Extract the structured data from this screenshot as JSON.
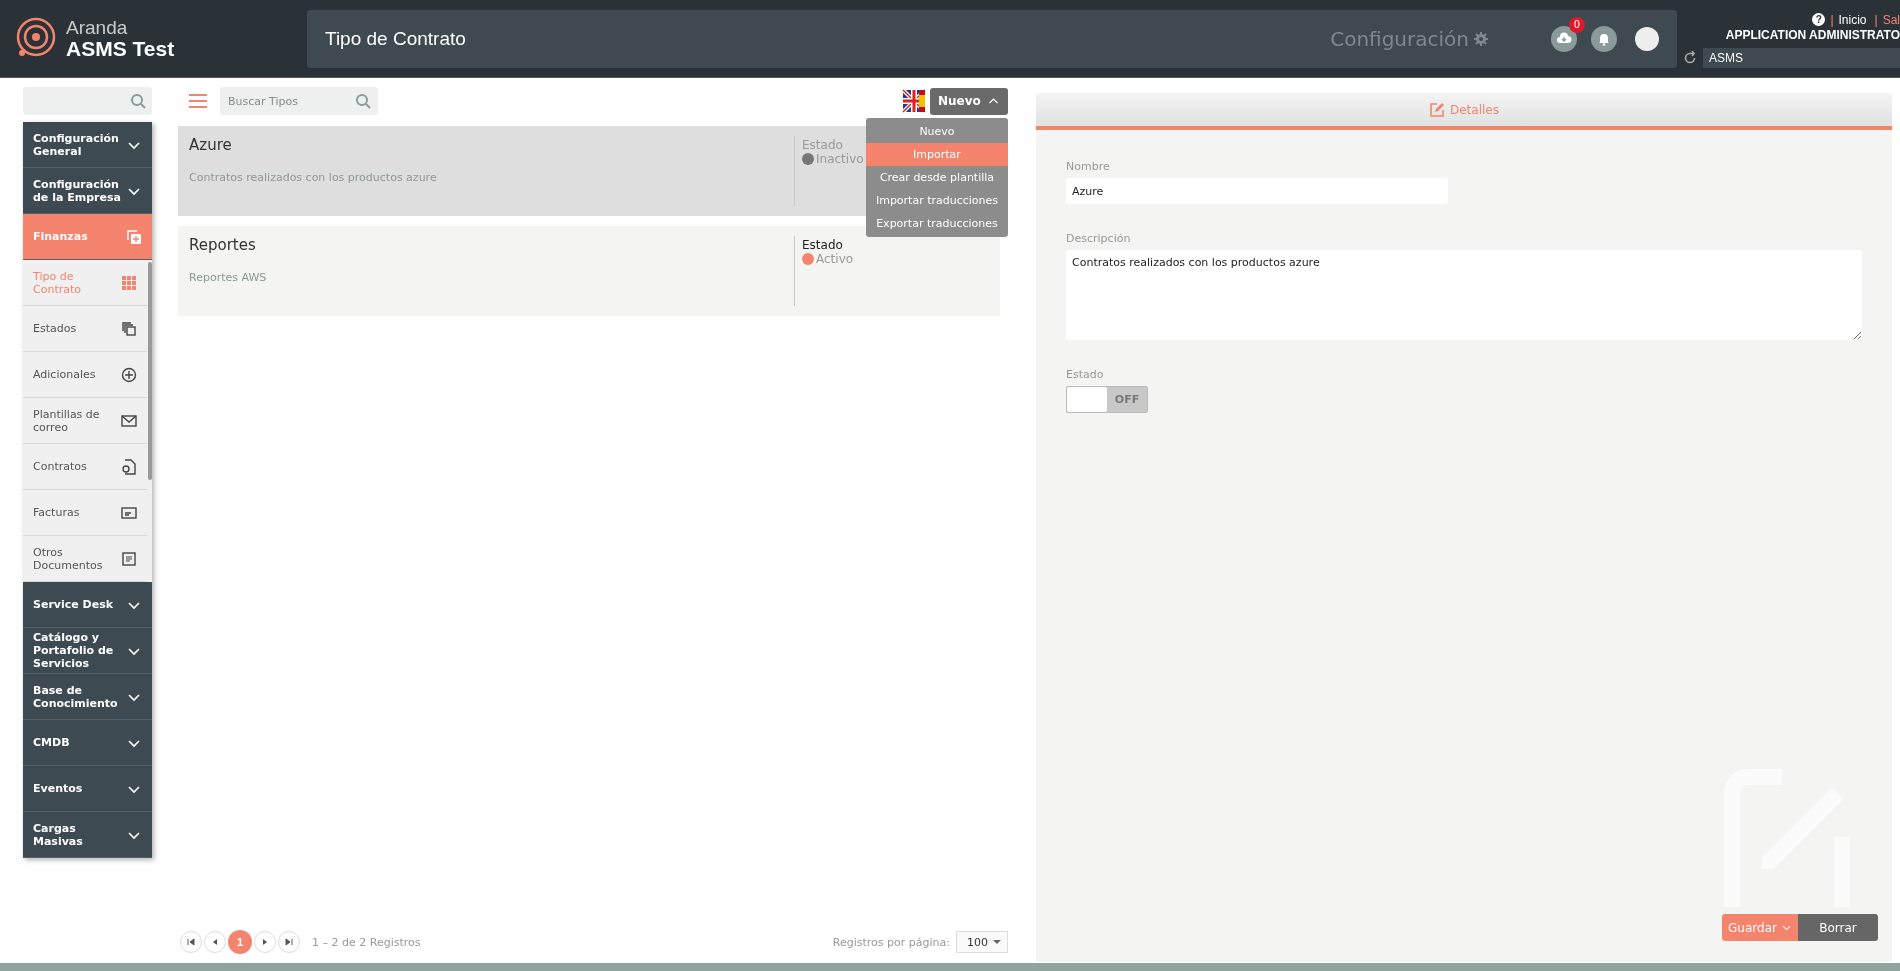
{
  "header": {
    "brand_top": "Aranda",
    "brand_bottom": "ASMS Test",
    "page_title": "Tipo de Contrato",
    "module": "Configuración",
    "download_badge": "0",
    "help": "?",
    "links": [
      {
        "separator": "|",
        "label": "Inicio",
        "kind": "home"
      },
      {
        "separator": "|",
        "label": "Sal",
        "kind": "exit"
      }
    ],
    "user": "APPLICATION ADMINISTRATO",
    "project": "ASMS"
  },
  "sidebar": {
    "sections": [
      {
        "label": "Configuración General",
        "expanded": false
      },
      {
        "label": "Configuración de la Empresa",
        "expanded": false
      },
      {
        "label": "Finanzas",
        "expanded": true,
        "children": [
          {
            "label": "Tipo de Contrato",
            "selected": true
          },
          {
            "label": "Estados",
            "selected": false
          },
          {
            "label": "Adicionales",
            "selected": false
          },
          {
            "label": "Plantillas de correo",
            "selected": false
          },
          {
            "label": "Contratos",
            "selected": false
          },
          {
            "label": "Facturas",
            "selected": false
          },
          {
            "label": "Otros Documentos",
            "selected": false
          }
        ]
      },
      {
        "label": "Service Desk",
        "expanded": false
      },
      {
        "label": "Catálogo y Portafolio de Servicios",
        "expanded": false
      },
      {
        "label": "Base de Conocimiento",
        "expanded": false
      },
      {
        "label": "CMDB",
        "expanded": false
      },
      {
        "label": "Eventos",
        "expanded": false
      },
      {
        "label": "Cargas Masivas",
        "expanded": false
      }
    ]
  },
  "toolbar": {
    "search_placeholder": "Buscar Tipos",
    "new_button": "Nuevo",
    "menu_open": true,
    "menu": [
      {
        "label": "Nuevo",
        "selected": false
      },
      {
        "label": "Importar",
        "selected": true
      },
      {
        "label": "Crear desde plantilla",
        "selected": false
      },
      {
        "label": "Importar traducciones",
        "selected": false
      },
      {
        "label": "Exportar traducciones",
        "selected": false
      }
    ]
  },
  "records": [
    {
      "name": "Azure",
      "description": "Contratos realizados con los productos azure",
      "status_label": "Estado",
      "status": "Inactivo",
      "active": false,
      "selected": true
    },
    {
      "name": "Reportes",
      "description": "Reportes AWS",
      "status_label": "Estado",
      "status": "Activo",
      "active": true,
      "selected": false
    }
  ],
  "pagination": {
    "pages": [
      {
        "label": "1",
        "selected": true
      }
    ],
    "summary": "1 – 2 de 2 Registros",
    "per_page_label": "Registros por página:",
    "per_page": "100"
  },
  "details": {
    "tab": "Detalles",
    "name_label": "Nombre",
    "name_value": "Azure",
    "description_label": "Descripción",
    "description_value": "Contratos realizados con los productos azure",
    "status_label": "Estado",
    "status_on": false,
    "status_off_text": "OFF",
    "save_button": "Guardar",
    "delete_button": "Borrar"
  }
}
